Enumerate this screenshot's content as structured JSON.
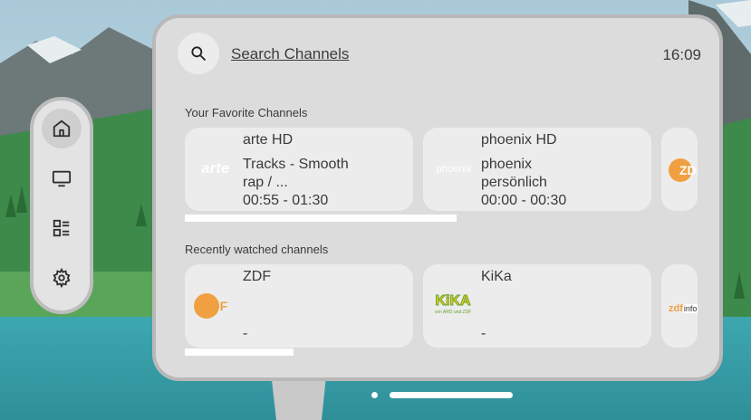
{
  "header": {
    "search_label": "Search Channels",
    "clock": "16:09"
  },
  "sidebar": {
    "items": [
      {
        "name": "home",
        "icon": "home-icon",
        "active": true
      },
      {
        "name": "tv",
        "icon": "tv-icon",
        "active": false
      },
      {
        "name": "guide",
        "icon": "list-icon",
        "active": false
      },
      {
        "name": "settings",
        "icon": "gear-icon",
        "active": false
      }
    ]
  },
  "favorites": {
    "title": "Your Favorite Channels",
    "cards": [
      {
        "channel": "arte HD",
        "logo": "arte",
        "program_line1": "Tracks - Smooth",
        "program_line2": "rap / ...",
        "time": "00:55 - 01:30"
      },
      {
        "channel": "phoenix HD",
        "logo": "phoenix",
        "program_line1": "phoenix",
        "program_line2": "persönlich",
        "time": "00:00 - 00:30"
      },
      {
        "logo": "ZDF"
      }
    ],
    "progress": 0.8
  },
  "recent": {
    "title": "Recently watched channels",
    "cards": [
      {
        "channel": "ZDF",
        "logo": "ZDF",
        "time": "-"
      },
      {
        "channel": "KiKa",
        "logo": "KiKA",
        "logo_sub": "von ARD und ZDF",
        "time": "-"
      },
      {
        "logo": "zdf",
        "logo_sub": "info"
      }
    ],
    "progress": 0.35
  },
  "colors": {
    "accent_orange": "#f0a040",
    "panel": "#dcdcdc",
    "card": "#ececec"
  }
}
